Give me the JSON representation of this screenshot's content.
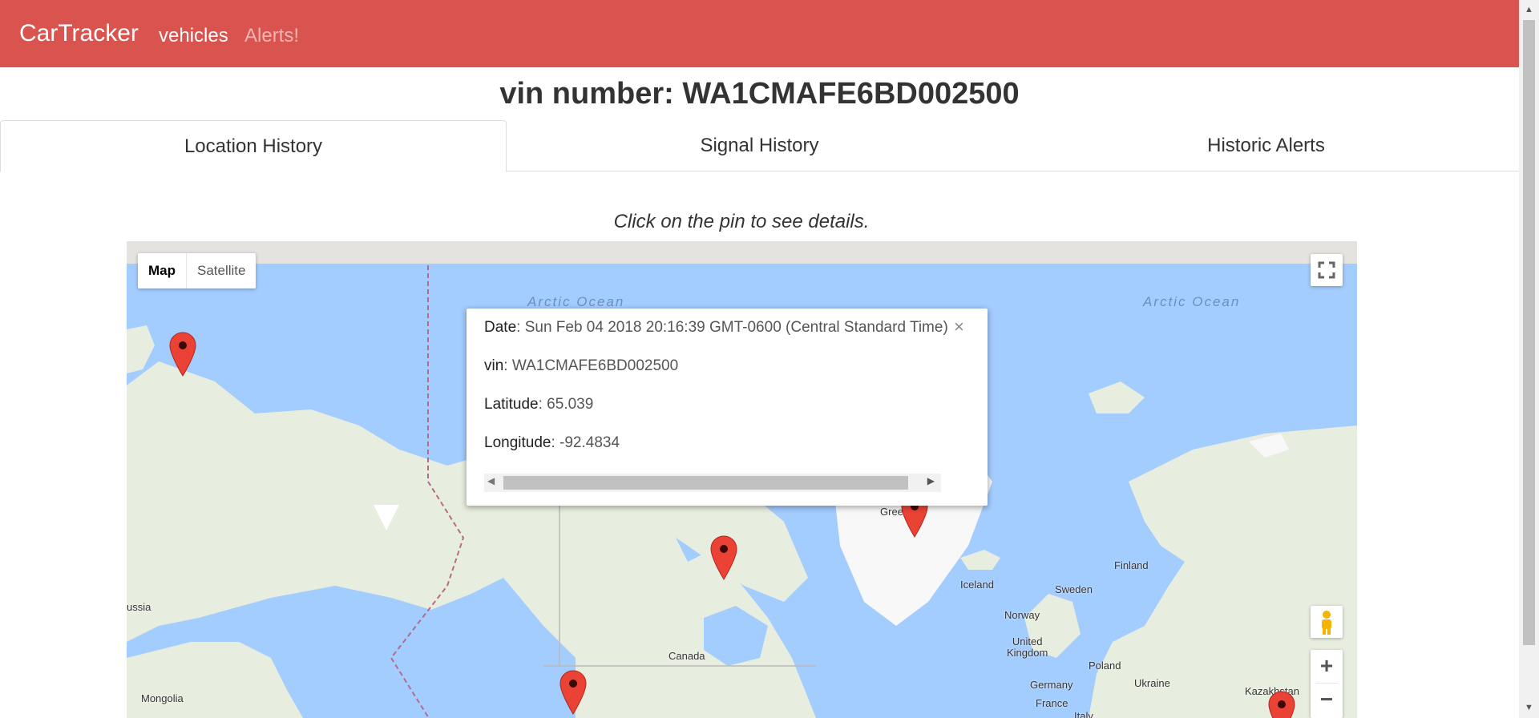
{
  "navbar": {
    "brand": "CarTracker",
    "links": [
      "vehicles",
      "Alerts!"
    ]
  },
  "page": {
    "title": "vin number: WA1CMAFE6BD002500"
  },
  "tabs": [
    "Location History",
    "Signal History",
    "Historic Alerts"
  ],
  "hint": "Click on the pin to see details.",
  "map": {
    "type_buttons": [
      "Map",
      "Satellite"
    ],
    "labels": {
      "ocean_left": "Arctic Ocean",
      "ocean_right": "Arctic Ocean",
      "greenland": "Green",
      "iceland": "Iceland",
      "finland": "Finland",
      "sweden": "Sweden",
      "norway": "Norway",
      "uk": "United\nKingdom",
      "poland": "Poland",
      "germany": "Germany",
      "ukraine": "Ukraine",
      "france": "France",
      "italy": "Italy",
      "kazakhstan": "Kazakhstan",
      "canada": "Canada",
      "russia": "ussia",
      "mongolia": "Mongolia"
    },
    "zoom_in": "+",
    "zoom_out": "−",
    "icons": [
      "fullscreen-icon",
      "pegman-icon",
      "map-pin-icon"
    ]
  },
  "info_window": {
    "date_key": "Date",
    "date_value": ": Sun Feb 04 2018 20:16:39 GMT-0600 (Central Standard Time)",
    "vin_key": "vin",
    "vin_value": ": WA1CMAFE6BD002500",
    "lat_key": "Latitude",
    "lat_value": ": 65.039",
    "lon_key": "Longitude",
    "lon_value": ": -92.4834",
    "close": "×"
  },
  "colors": {
    "navbar": "#d9534f",
    "water": "#a3ccff",
    "land": "#e8eedf",
    "pin": "#ea4335"
  }
}
